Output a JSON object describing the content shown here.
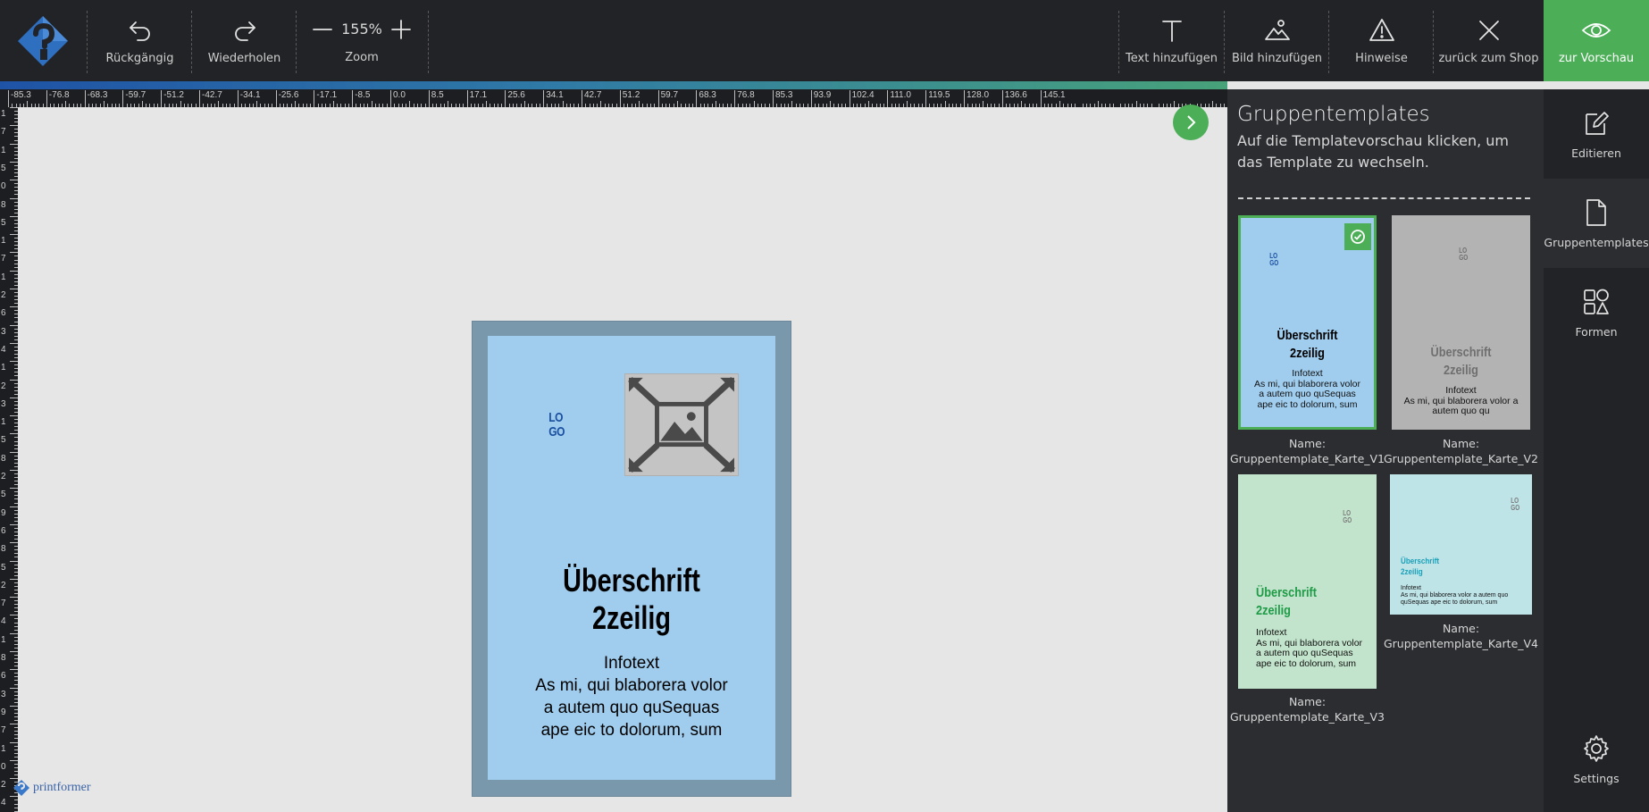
{
  "toolbar": {
    "undo_label": "Rückgängig",
    "redo_label": "Wiederholen",
    "zoom_value": "155%",
    "zoom_label": "Zoom",
    "add_text_label": "Text hinzufügen",
    "add_image_label": "Bild hinzufügen",
    "hints_label": "Hinweise",
    "back_to_shop_label": "zurück zum Shop",
    "preview_label": "zur Vorschau"
  },
  "ruler": {
    "top_labels": [
      "-85.3",
      "-76.8",
      "-68.3",
      "-59.7",
      "-51.2",
      "-42.7",
      "-34.1",
      "-25.6",
      "-17.1",
      "-8.5",
      "0.0",
      "8.5",
      "17.1",
      "25.6",
      "34.1",
      "42.7",
      "51.2",
      "59.7",
      "68.3",
      "76.8",
      "85.3",
      "93.9",
      "102.4",
      "111.0",
      "119.5",
      "128.0",
      "136.6",
      "145.1"
    ],
    "left_labels": [
      "1",
      "7",
      "1",
      "5",
      "0",
      "8",
      "5",
      "1",
      "7",
      "1",
      "2",
      "6",
      "3",
      "4",
      "1",
      "2",
      "3",
      "1",
      "5",
      "8",
      "2",
      "5",
      "9",
      "6",
      "8",
      "5",
      "2",
      "7",
      "4",
      "1",
      "8",
      "6",
      "3",
      "9",
      "7",
      "1",
      "0",
      "2",
      "4"
    ]
  },
  "card": {
    "logo": "LO\nGO",
    "heading_line1": "Überschrift",
    "heading_line2": "2zeilig",
    "info_text": "Infotext\nAs mi, qui blaborera volor\na autem quo quSequas\nape eic to dolorum, sum"
  },
  "brand": {
    "name": "printformer"
  },
  "panel": {
    "title": "Gruppentemplates",
    "description": "Auf die Templatevorschau klicken, um das Template zu wechseln.",
    "name_prefix": "Name:",
    "templates": [
      {
        "name": "Gruppentemplate_Karte_V1",
        "selected": true,
        "bg": "#a0cdee",
        "logo_color": "#1a4fa0",
        "heading_color": "#000000",
        "logo": "LO\nGO",
        "heading": "Überschrift\n2zeilig",
        "info": "Infotext\nAs mi, qui blaborera volor\na autem quo quSequas\nape eic to dolorum, sum"
      },
      {
        "name": "Gruppentemplate_Karte_V2",
        "selected": false,
        "bg": "#b3b3b3",
        "logo_color": "#6f6f6f",
        "heading_color": "#6f6f6f",
        "logo": "LO\nGO",
        "heading": "Überschrift\n2zeilig",
        "info": "Infotext\nAs mi, qui blaborera volor a\nautem quo qu"
      },
      {
        "name": "Gruppentemplate_Karte_V3",
        "selected": false,
        "bg": "#c3e4cc",
        "logo_color": "#7b7b7b",
        "heading_color": "#1e9b46",
        "logo": "LO\nGO",
        "heading": "Überschrift\n2zeilig",
        "info": "Infotext\nAs mi, qui blaborera volor\na autem quo quSequas\nape eic to dolorum, sum"
      },
      {
        "name": "Gruppentemplate_Karte_V4",
        "selected": false,
        "bg": "#bfe4e8",
        "logo_color": "#7b7b7b",
        "heading_color": "#1aa0b8",
        "logo": "LO\nGO",
        "heading": "Überschrift\n2zeilig",
        "info": "Infotext\nAs mi, qui blaborera volor a autem quo\nquSequas ape eic to dolorum, sum"
      }
    ]
  },
  "sidetabs": {
    "edit_label": "Editieren",
    "group_templates_label": "Gruppentemplates",
    "shapes_label": "Formen",
    "settings_label": "Settings"
  },
  "colors": {
    "accent": "#4caf58",
    "toolbar_bg": "#222326",
    "panel_bg": "#2c2d31",
    "card_bg": "#a0cdee",
    "card_border": "#7a98ab"
  }
}
